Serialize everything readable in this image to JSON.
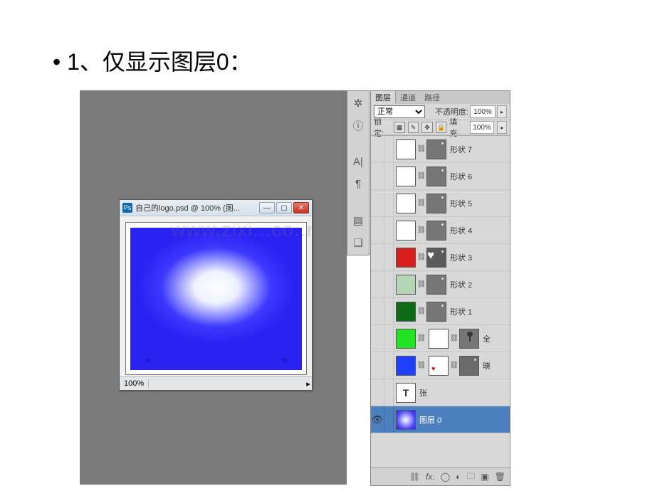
{
  "slide": {
    "title": "• 1、仅显示图层0："
  },
  "doc": {
    "title": "自己的logo.psd @ 100% (图...",
    "zoom": "100%"
  },
  "panel": {
    "tabs": {
      "layers": "图层",
      "channels": "通道",
      "paths": "路径"
    },
    "blend": "正常",
    "opacity_label": "不透明度:",
    "opacity_value": "100%",
    "lock_label": "锁定:",
    "fill_label": "填充:",
    "fill_value": "100%"
  },
  "layers": {
    "l7": "形状 7",
    "l6": "形状 6",
    "l5": "形状 5",
    "l4": "形状 4",
    "l3": "形状 3",
    "l2": "形状 2",
    "l1": "形状 1",
    "quan": "全",
    "xiao": "晓",
    "zhang": "张",
    "layer0": "图层 0"
  },
  "watermark": "www.zixi...co..n"
}
